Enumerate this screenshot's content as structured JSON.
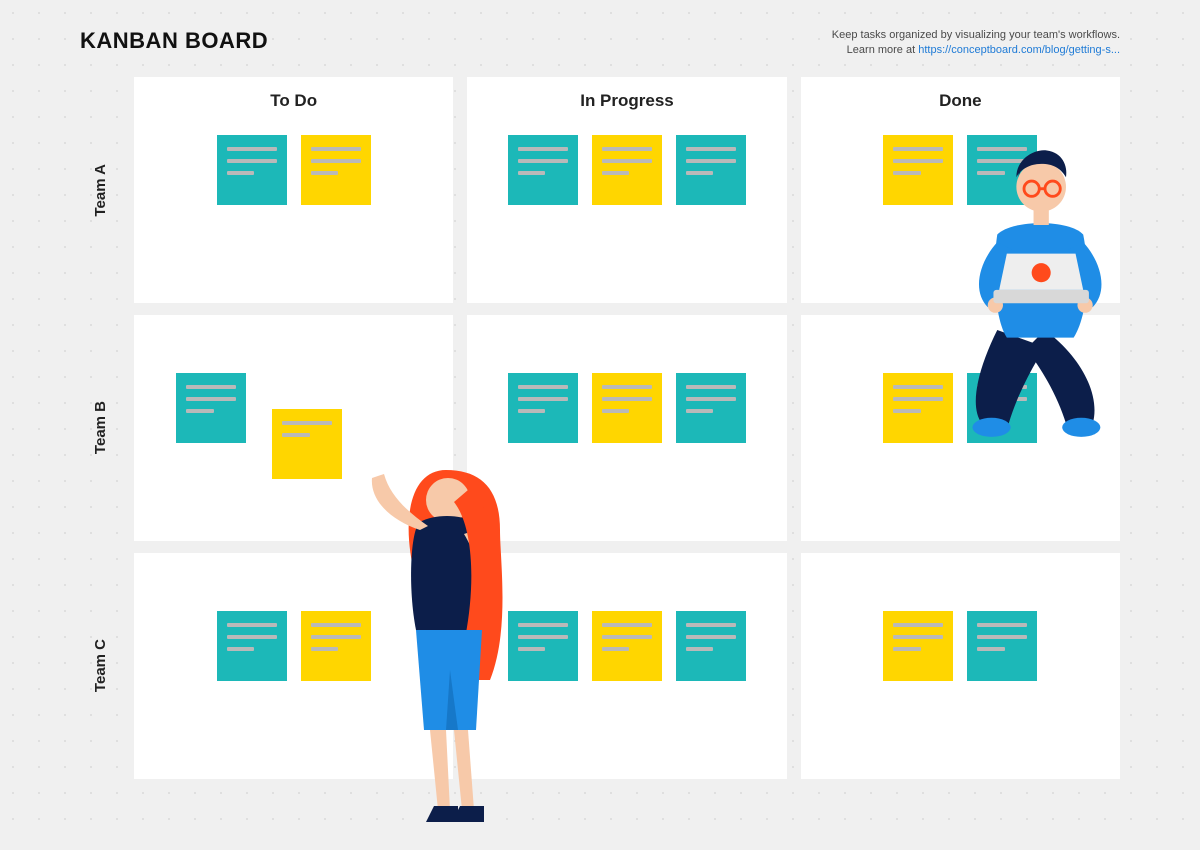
{
  "title": "KANBAN BOARD",
  "help": {
    "line1": "Keep tasks organized by visualizing your team's workflows.",
    "line2_prefix": "Learn more at ",
    "link_text": "https://conceptboard.com/blog/getting-s..."
  },
  "columns": [
    {
      "label": "To Do"
    },
    {
      "label": "In Progress"
    },
    {
      "label": "Done"
    }
  ],
  "rows": [
    {
      "label": "Team A"
    },
    {
      "label": "Team B"
    },
    {
      "label": "Team C"
    }
  ],
  "colors": {
    "teal": "#1cb8b8",
    "yellow": "#ffd600",
    "line": "#b9b9b9",
    "panel": "#ffffff",
    "bg": "#f0f0f0"
  },
  "cells": {
    "a_todo": [
      {
        "color": "teal"
      },
      {
        "color": "yellow"
      }
    ],
    "a_inprog": [
      {
        "color": "teal"
      },
      {
        "color": "yellow"
      },
      {
        "color": "teal"
      }
    ],
    "a_done": [
      {
        "color": "yellow"
      },
      {
        "color": "teal"
      }
    ],
    "b_todo": [
      {
        "color": "teal"
      },
      {
        "color": "yellow"
      }
    ],
    "b_inprog": [
      {
        "color": "teal"
      },
      {
        "color": "yellow"
      },
      {
        "color": "teal"
      }
    ],
    "b_done": [
      {
        "color": "yellow"
      },
      {
        "color": "teal"
      }
    ],
    "c_todo": [
      {
        "color": "teal"
      },
      {
        "color": "yellow"
      }
    ],
    "c_inprog": [
      {
        "color": "teal"
      },
      {
        "color": "yellow"
      },
      {
        "color": "teal"
      }
    ],
    "c_done": [
      {
        "color": "yellow"
      },
      {
        "color": "teal"
      }
    ]
  }
}
